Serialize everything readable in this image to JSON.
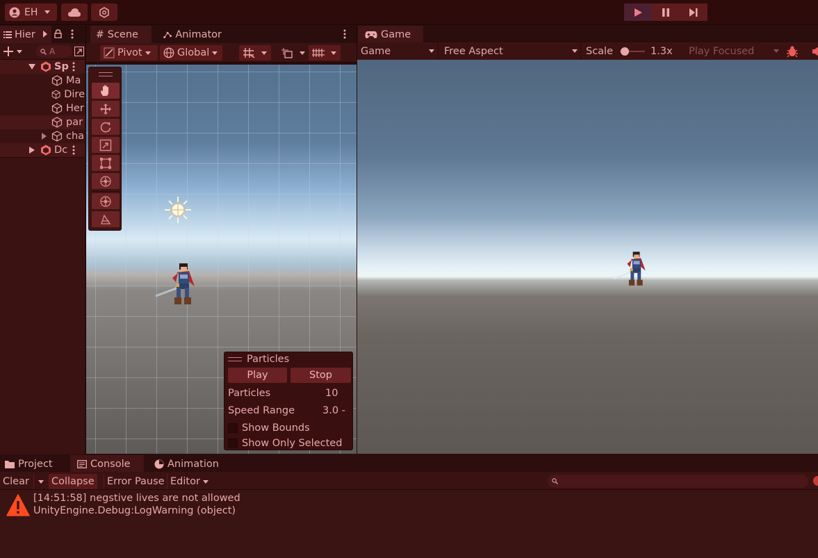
{
  "toolbar": {
    "account_label": "EH",
    "colors": {
      "bg": "#2d0b0b",
      "button": "#5a1a1b",
      "play_active": "#5e1c1e"
    }
  },
  "hierarchy": {
    "tab_label": "Hier",
    "search_placeholder": "A",
    "items": [
      {
        "label": "Sp",
        "type": "scene",
        "expanded": true
      },
      {
        "label": "Ma",
        "type": "gameobject"
      },
      {
        "label": "Dire",
        "type": "gameobject"
      },
      {
        "label": "Her",
        "type": "gameobject"
      },
      {
        "label": "par",
        "type": "gameobject",
        "selected": true
      },
      {
        "label": "cha",
        "type": "gameobject",
        "collapsed": true
      },
      {
        "label": "Dc",
        "type": "scene",
        "expanded": false
      }
    ]
  },
  "scene": {
    "tabs": [
      {
        "label": "Scene",
        "icon": "grid-icon",
        "active": true
      },
      {
        "label": "Animator",
        "icon": "animator-icon",
        "active": false
      }
    ],
    "pivot_label": "Pivot",
    "global_label": "Global"
  },
  "particles": {
    "title": "Particles",
    "play_label": "Play",
    "stop_label": "Stop",
    "count_label": "Particles",
    "count_value": "10",
    "speed_label": "Speed Range",
    "speed_value": "3.0 -",
    "show_bounds_label": "Show Bounds",
    "show_only_selected_label": "Show Only Selected"
  },
  "game": {
    "tab_label": "Game",
    "display_label": "Game",
    "aspect_label": "Free Aspect",
    "scale_label": "Scale",
    "scale_value": "1.3x",
    "scale_fraction": 0.05,
    "play_focused_label": "Play Focused"
  },
  "console": {
    "tabs": [
      {
        "label": "Project",
        "icon": "folder-icon",
        "active": false
      },
      {
        "label": "Console",
        "icon": "console-icon",
        "active": true
      },
      {
        "label": "Animation",
        "icon": "animation-icon",
        "active": false
      }
    ],
    "clear_label": "Clear",
    "collapse_label": "Collapse",
    "error_pause_label": "Error Pause",
    "editor_label": "Editor",
    "entries": [
      {
        "line1": "[14:51:58] negstive lives are not allowed",
        "line2": "UnityEngine.Debug:LogWarning (object)",
        "level": "warning"
      }
    ],
    "warning_color": "#ff4b1f"
  }
}
